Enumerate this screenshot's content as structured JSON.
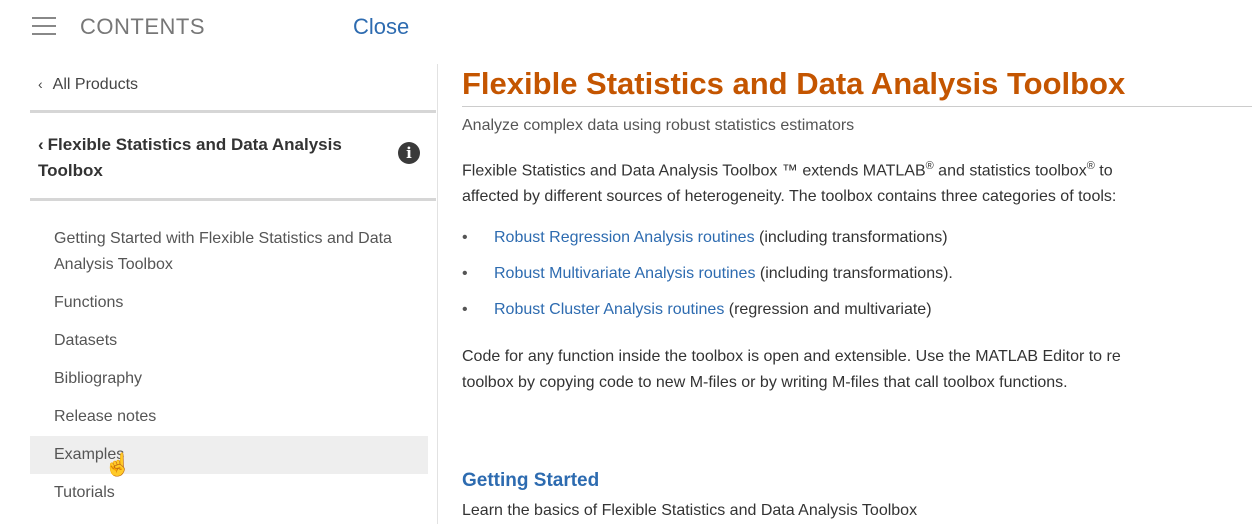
{
  "topbar": {
    "contents_label": "CONTENTS",
    "close_label": "Close"
  },
  "sidebar": {
    "back_label": "All Products",
    "toolbox_title": "Flexible Statistics and Data Analysis Toolbox",
    "items": [
      {
        "label": "Getting Started with Flexible Statistics and Data Analysis Toolbox"
      },
      {
        "label": "Functions"
      },
      {
        "label": "Datasets"
      },
      {
        "label": "Bibliography"
      },
      {
        "label": "Release notes"
      },
      {
        "label": "Examples"
      },
      {
        "label": "Tutorials"
      }
    ]
  },
  "main": {
    "title": "Flexible Statistics and Data Analysis Toolbox",
    "subtitle": "Analyze complex data using robust statistics estimators",
    "intro": {
      "part1": "Flexible Statistics and Data Analysis Toolbox ™ extends MATLAB",
      "reg1": "®",
      "part2": " and statistics toolbox",
      "reg2": "®",
      "part3": " to",
      "line2": "affected by different sources of heterogeneity. The toolbox contains three categories of tools:"
    },
    "bullets": [
      {
        "link": "Robust Regression Analysis routines",
        "rest": " (including transformations)"
      },
      {
        "link": "Robust Multivariate Analysis routines",
        "rest": " (including transformations)."
      },
      {
        "link": "Robust Cluster Analysis routines",
        "rest": " (regression and multivariate)"
      }
    ],
    "para2": {
      "line1": "Code for any function inside the toolbox is open and extensible. Use the MATLAB Editor to re",
      "line2": "toolbox by copying code to new M-files or by writing M-files that call toolbox functions."
    },
    "getting_started": {
      "heading": "Getting Started",
      "text": "Learn the basics of Flexible Statistics and Data Analysis Toolbox"
    }
  },
  "colors": {
    "title_orange": "#c45500",
    "link_blue": "#2d6bb0"
  },
  "icons": {
    "menu": "hamburger-menu-icon",
    "back": "chevron-left-icon",
    "info": "info-icon",
    "cursor": "hand-pointer-icon"
  }
}
